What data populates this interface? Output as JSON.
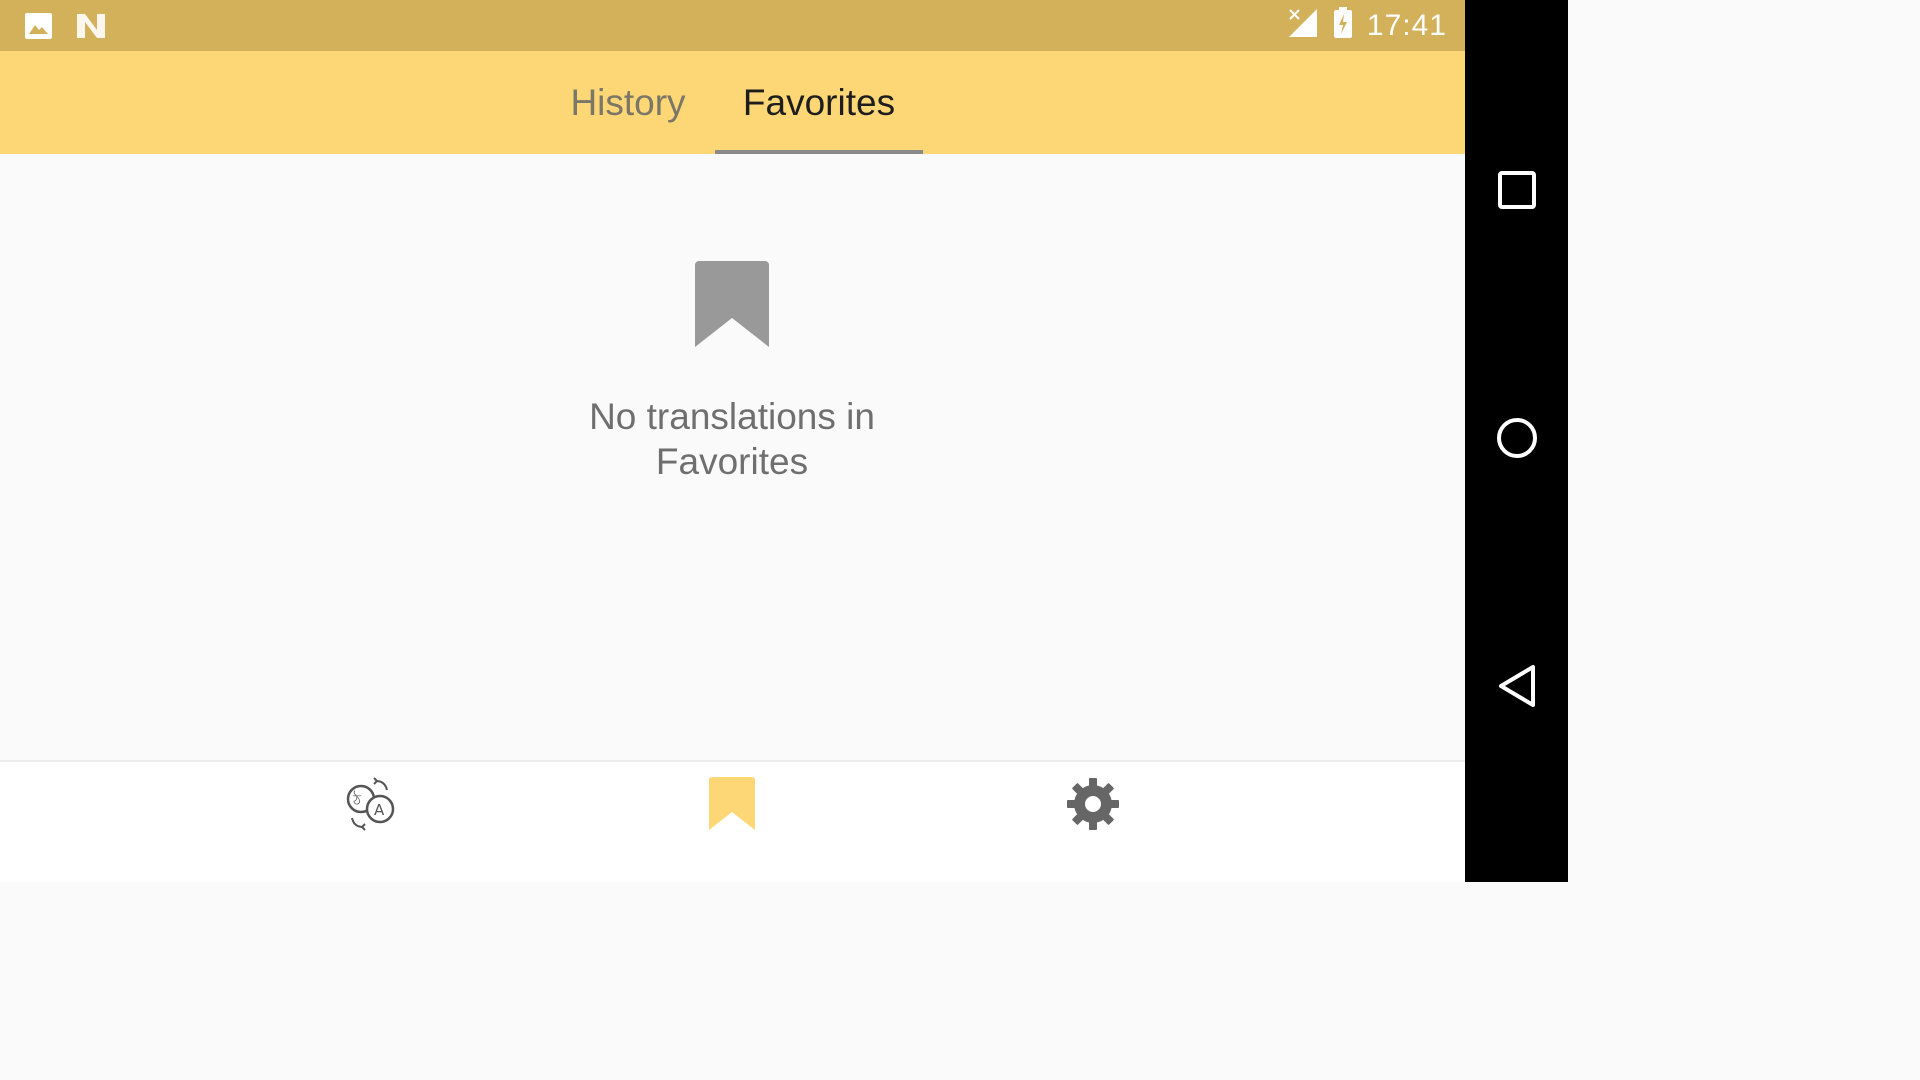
{
  "status_bar": {
    "time": "17:41",
    "icons": [
      "image-icon",
      "n-logo-icon",
      "no-signal-icon",
      "battery-charging-icon"
    ],
    "background": "#d3b05a"
  },
  "tabs": [
    {
      "label": "History",
      "active": false
    },
    {
      "label": "Favorites",
      "active": true
    }
  ],
  "empty_state": {
    "icon": "bookmark-icon",
    "message": "No translations in\nFavorites"
  },
  "bottom_nav": [
    {
      "icon": "translate-icon",
      "active": false
    },
    {
      "icon": "bookmark-icon",
      "active": true
    },
    {
      "icon": "gear-icon",
      "active": false
    }
  ],
  "system_nav": [
    "recents-square-icon",
    "home-circle-icon",
    "back-triangle-icon"
  ],
  "colors": {
    "accent": "#fdd675",
    "status": "#d3b05a",
    "icon_gray": "#999999",
    "text_gray": "#6f6f6f"
  }
}
